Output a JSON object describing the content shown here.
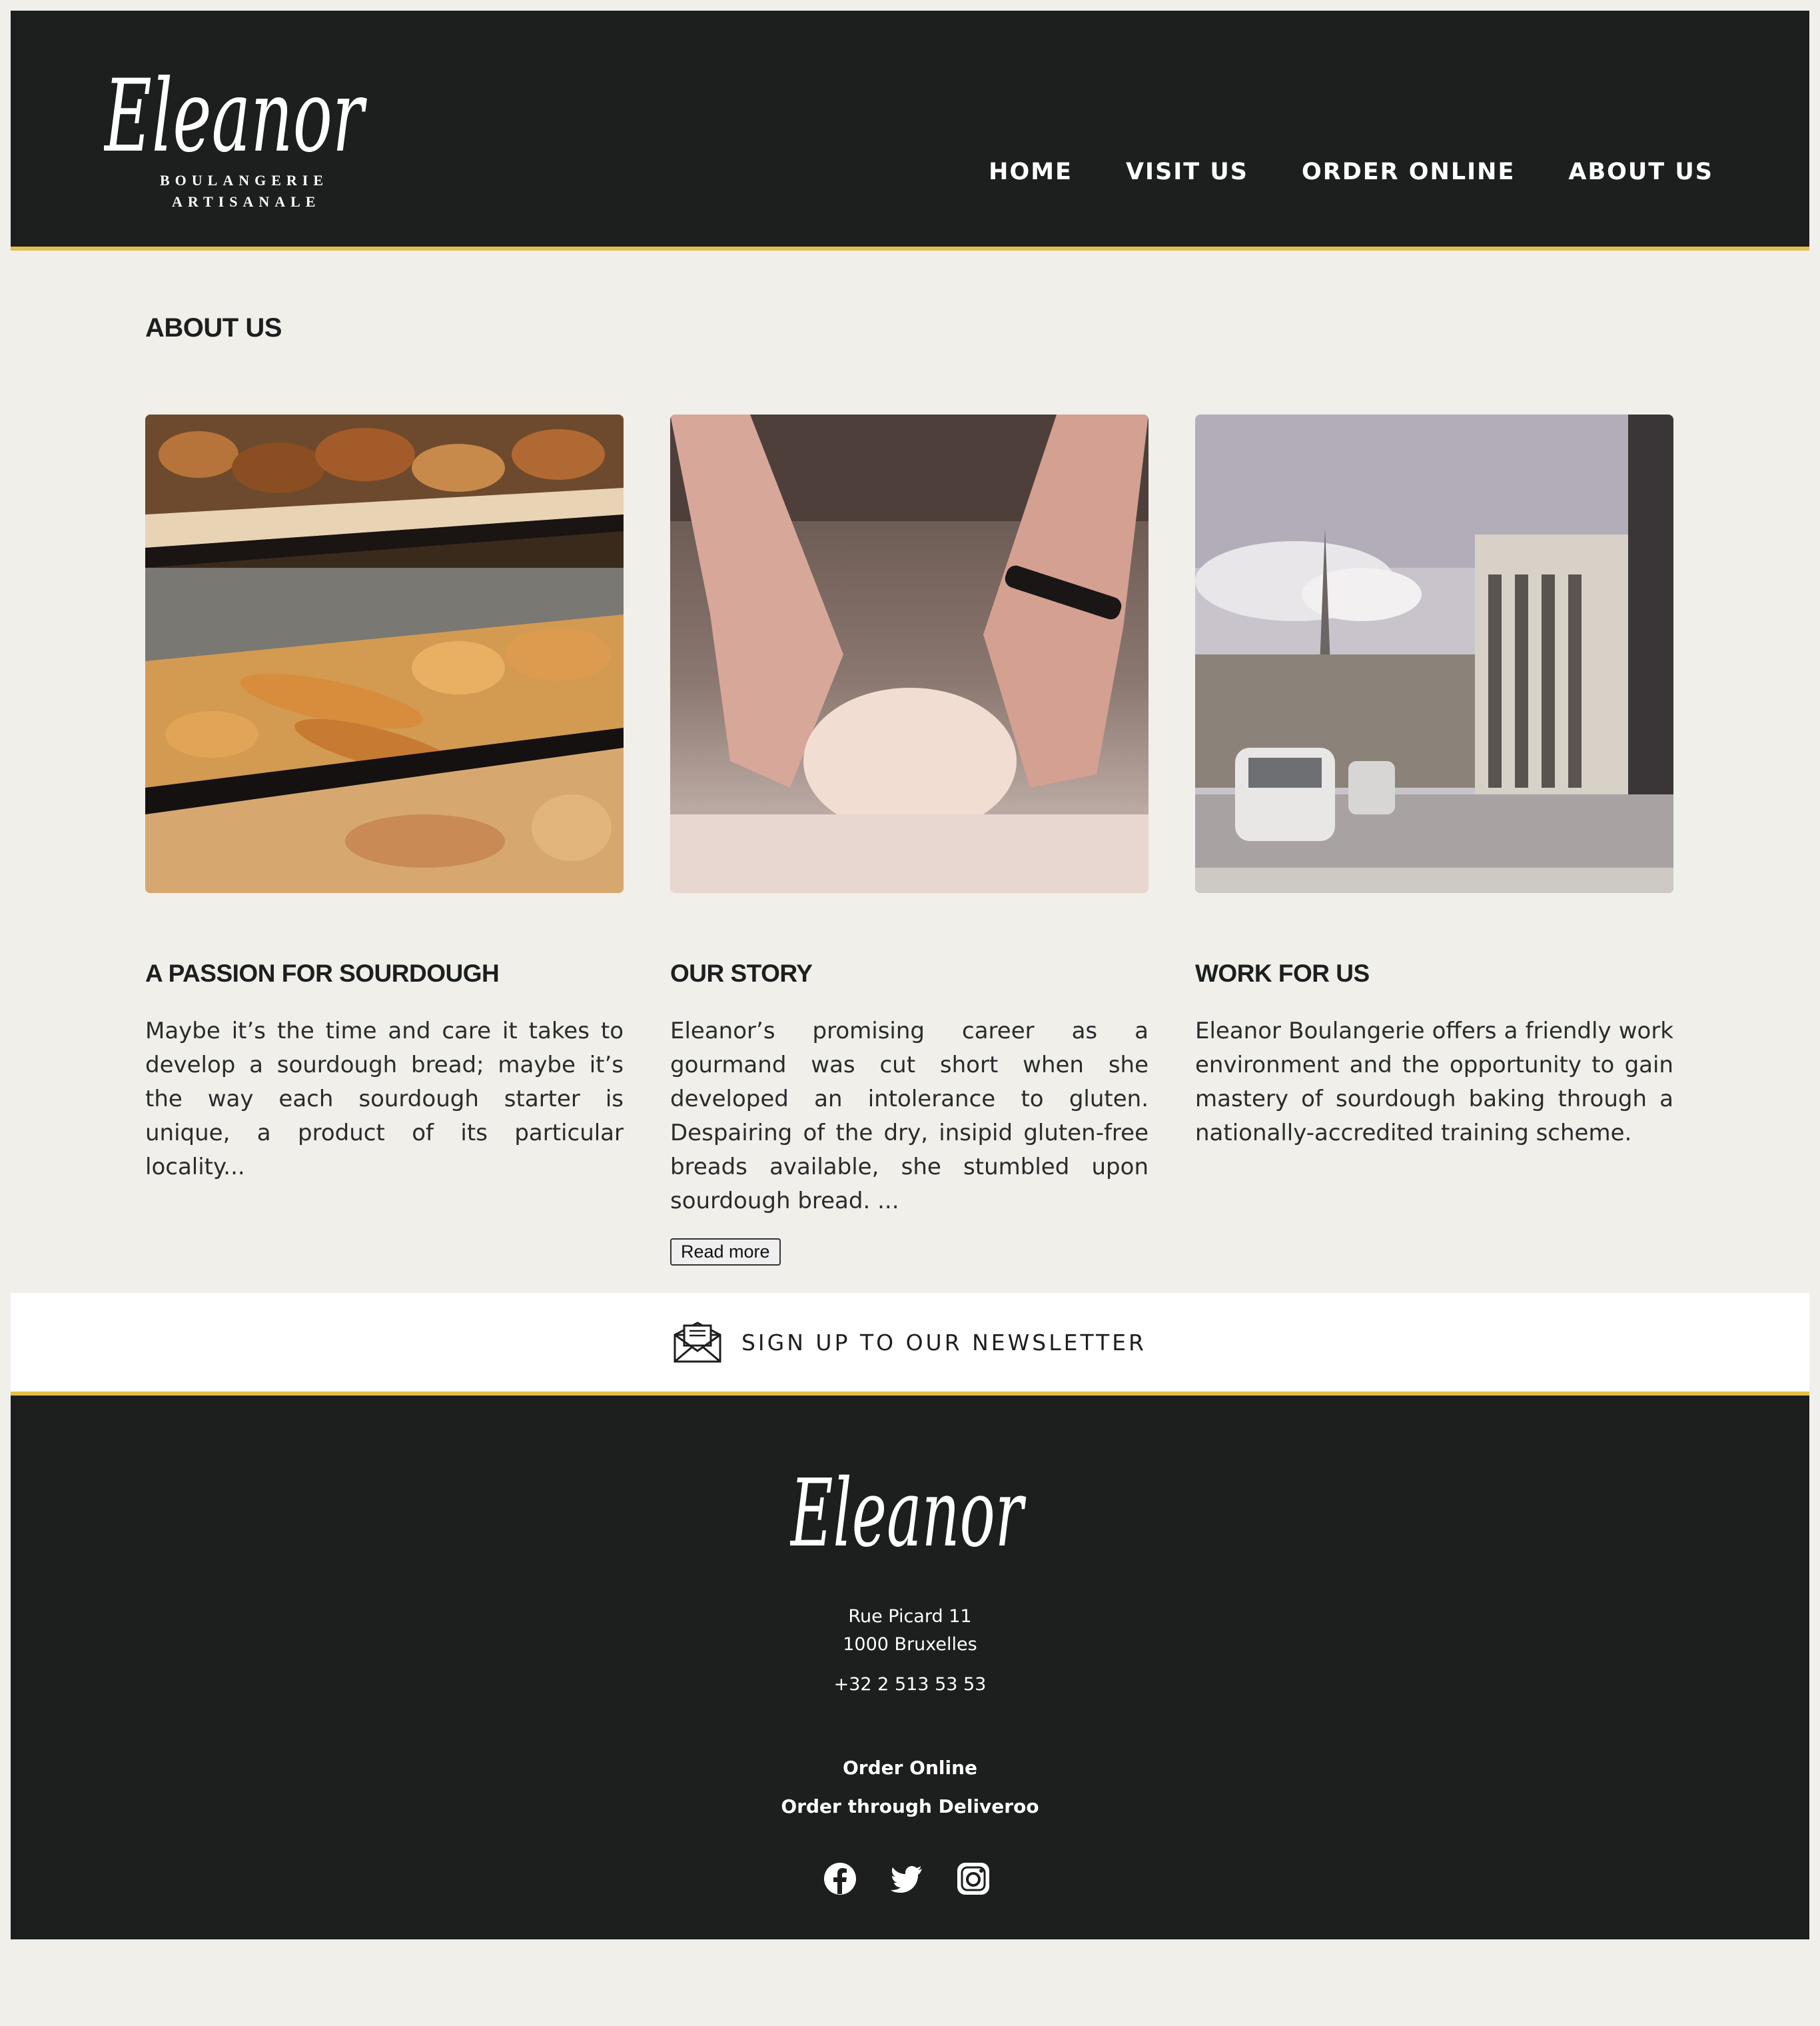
{
  "brand": {
    "name": "Eleanor",
    "subtitle_line1": "BOULANGERIE",
    "subtitle_line2": "ARTISANALE"
  },
  "nav": [
    "HOME",
    "VISIT US",
    "ORDER ONLINE",
    "ABOUT US"
  ],
  "page": {
    "title": "ABOUT US"
  },
  "cards": [
    {
      "title": "A PASSION FOR SOURDOUGH",
      "text": "Maybe it’s the time and care it takes to develop a sourdough bread; maybe it’s the way each sourdough starter is unique, a product of its particular locality...",
      "image": "bakery-shelves-photo"
    },
    {
      "title": "OUR STORY",
      "text": "Eleanor’s promising career as a gourmand was cut short when she developed an intolerance to gluten. Despairing of the dry, insipid gluten-free breads available, she stumbled upon sourdough bread. ...",
      "button": "Read more",
      "image": "kneading-dough-photo"
    },
    {
      "title": "WORK FOR US",
      "text": "Eleanor Boulangerie offers a friendly work environment and the opportunity to gain mastery of sourdough baking through a nationally-accredited training scheme.",
      "image": "brussels-street-photo"
    }
  ],
  "newsletter": {
    "label": "SIGN UP TO OUR NEWSLETTER",
    "icon": "envelope-icon"
  },
  "footer": {
    "address_line1": "Rue Picard 11",
    "address_line2": "1000 Bruxelles",
    "phone": "+32 2 513 53 53",
    "order_online": "Order Online",
    "order_deliveroo": "Order through Deliveroo",
    "social_icons": [
      "facebook-icon",
      "twitter-icon",
      "instagram-icon"
    ]
  },
  "colors": {
    "dark": "#1c1f1e",
    "accent": "#e3c04a",
    "background": "#f0efea"
  }
}
